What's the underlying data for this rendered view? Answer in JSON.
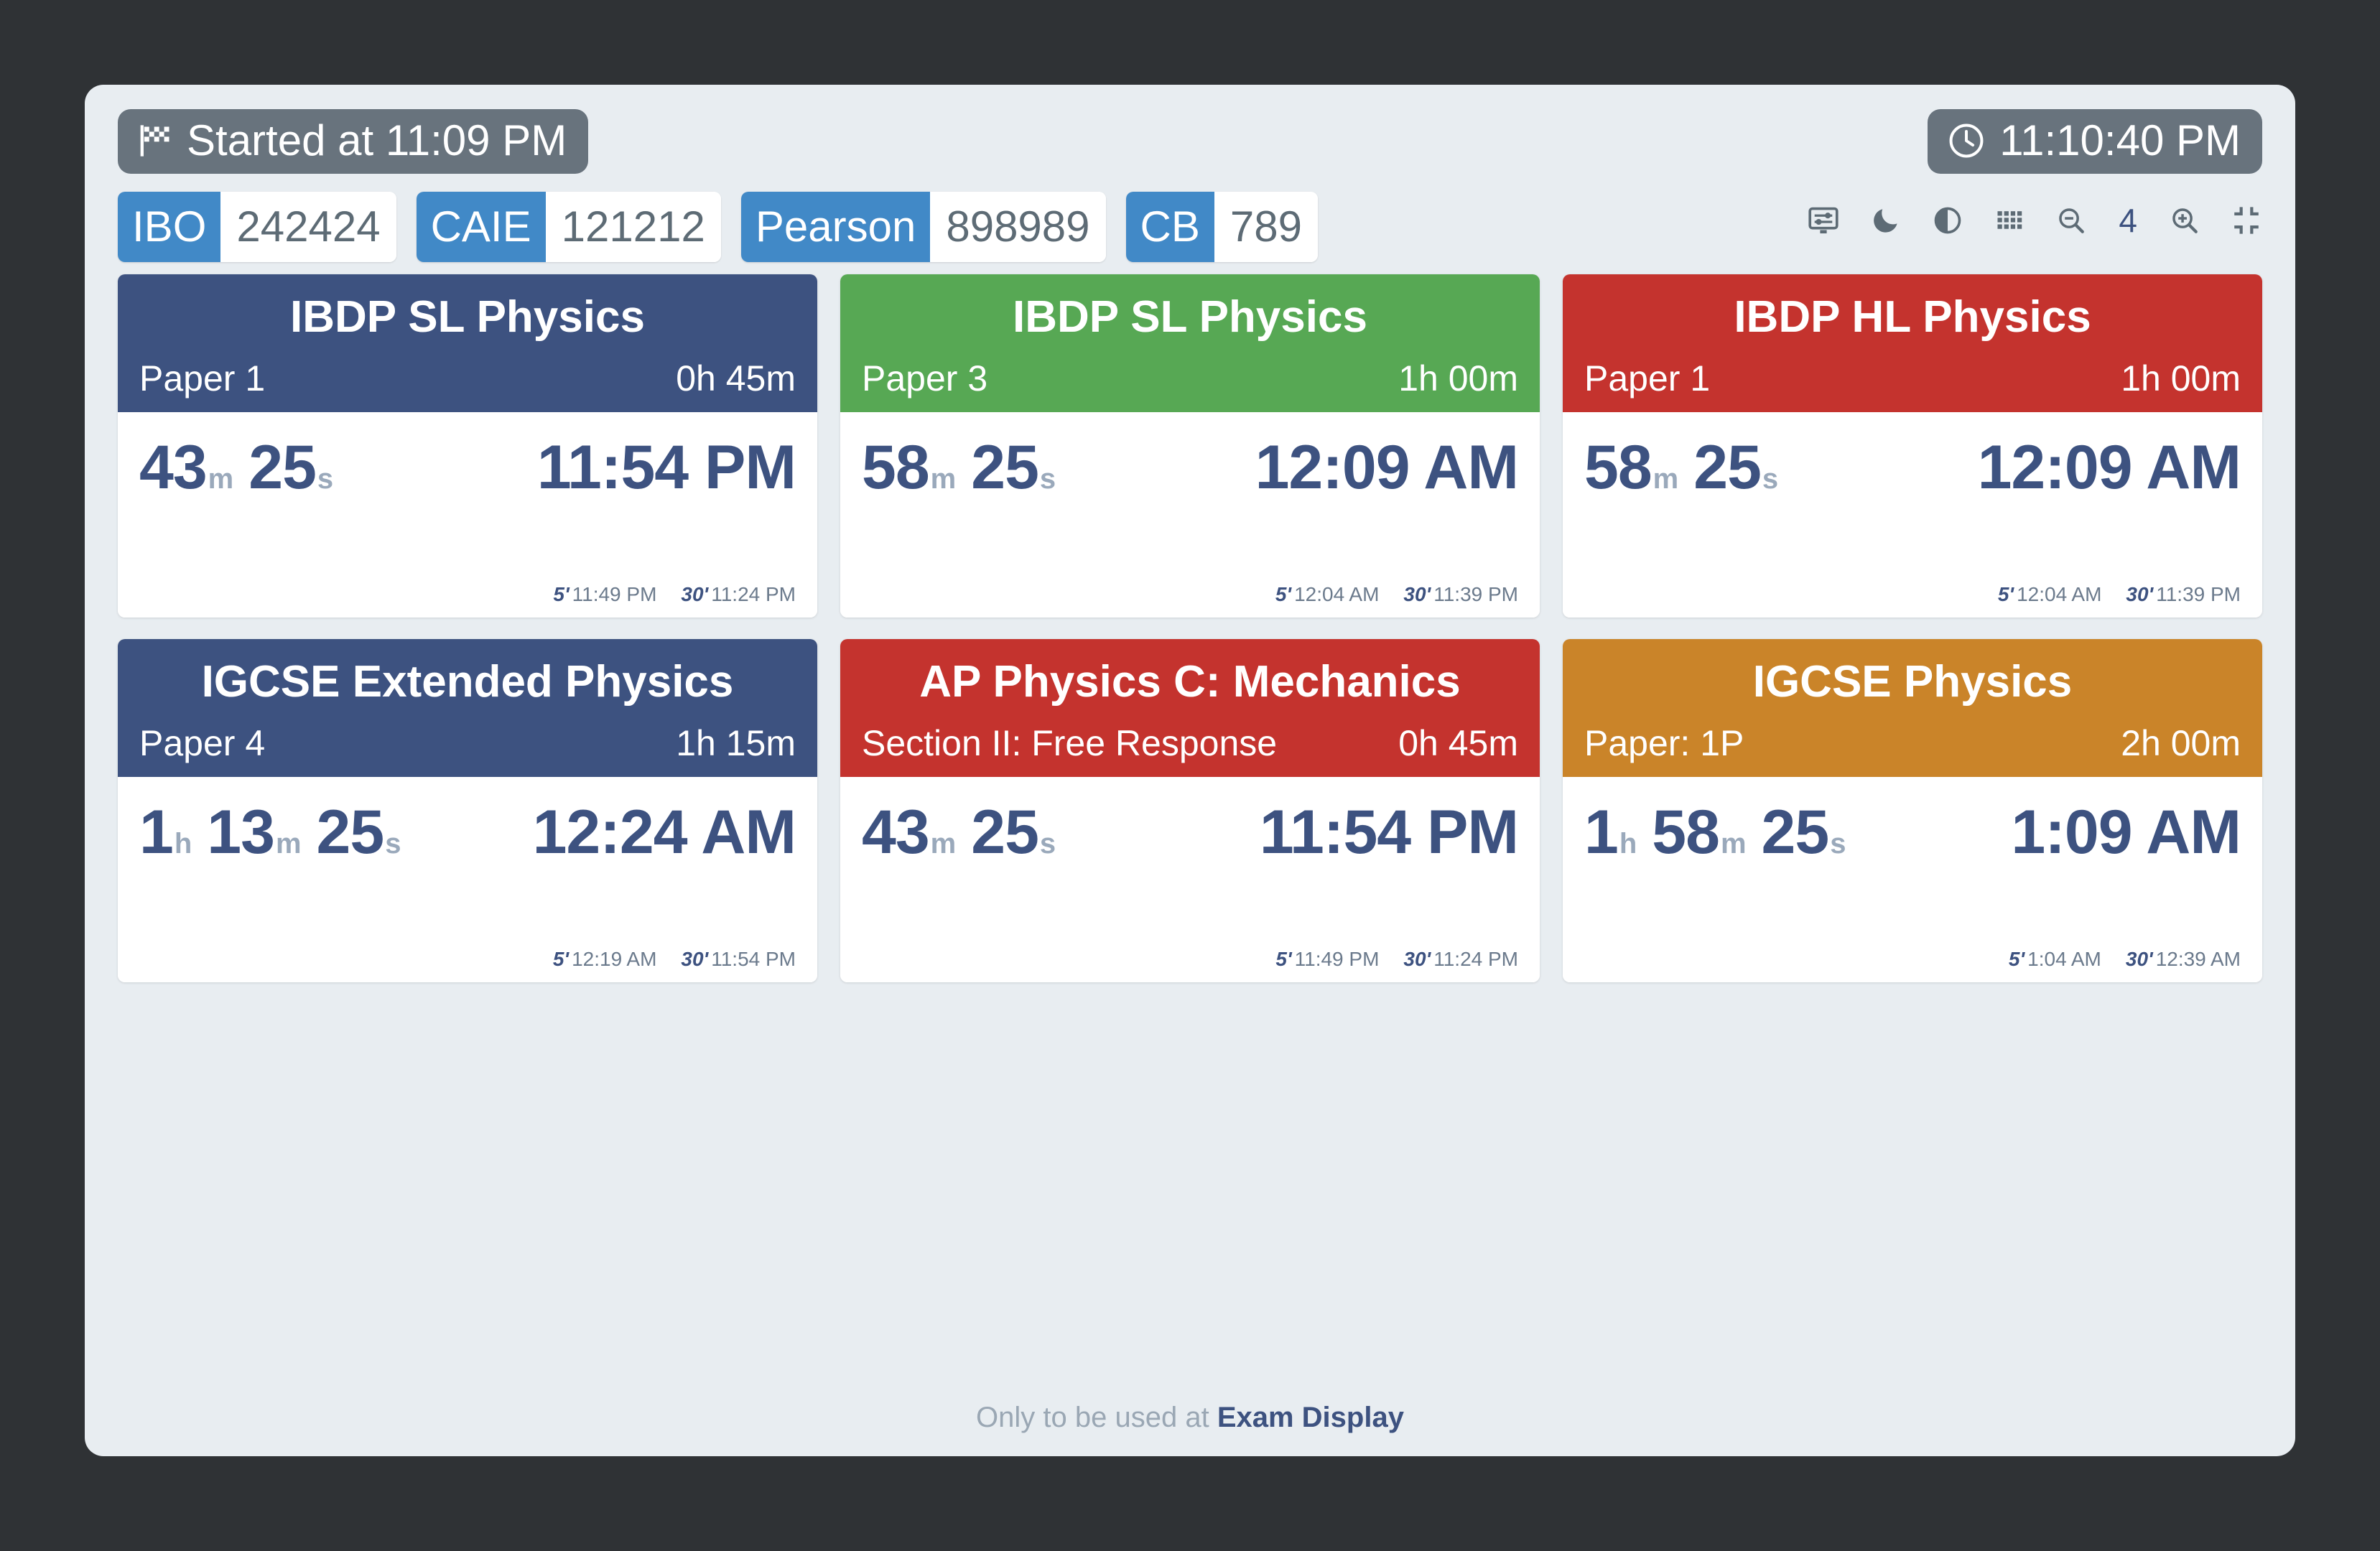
{
  "theme": {
    "page_background": "#2f3235",
    "panel_background": "#e8edf1",
    "accent_blue": "#4189c7",
    "navy": "#3d5280",
    "green": "#57a854",
    "red": "#c4332e",
    "orange": "#ca8429",
    "pill_gray": "#68737d"
  },
  "topbar": {
    "started": {
      "icon": "checkered-flag-icon",
      "label": "Started at 11:09 PM"
    },
    "clock": {
      "icon": "clock-icon",
      "time": "11:10:40 PM"
    }
  },
  "codes": [
    {
      "board": "IBO",
      "number": "242424"
    },
    {
      "board": "CAIE",
      "number": "121212"
    },
    {
      "board": "Pearson",
      "number": "898989"
    },
    {
      "board": "CB",
      "number": "789"
    }
  ],
  "toolbar": {
    "items": [
      {
        "icon": "display-settings-icon"
      },
      {
        "icon": "moon-icon"
      },
      {
        "icon": "contrast-icon"
      },
      {
        "icon": "grid-icon"
      },
      {
        "icon": "zoom-out-icon"
      }
    ],
    "zoom_level": "4",
    "zoom_in": {
      "icon": "zoom-in-icon"
    },
    "compress": {
      "icon": "compress-icon"
    }
  },
  "cards": [
    {
      "title": "IBDP SL Physics",
      "paper": "Paper 1",
      "duration": "0h 45m",
      "color": "#3d5280",
      "remaining": [
        {
          "value": "43",
          "unit": "m"
        },
        {
          "value": "25",
          "unit": "s"
        }
      ],
      "end_time": "11:54 PM",
      "warnings": [
        {
          "mark": "5'",
          "time": "11:49 PM"
        },
        {
          "mark": "30'",
          "time": "11:24 PM"
        }
      ]
    },
    {
      "title": "IBDP SL Physics",
      "paper": "Paper 3",
      "duration": "1h 00m",
      "color": "#57a854",
      "remaining": [
        {
          "value": "58",
          "unit": "m"
        },
        {
          "value": "25",
          "unit": "s"
        }
      ],
      "end_time": "12:09 AM",
      "warnings": [
        {
          "mark": "5'",
          "time": "12:04 AM"
        },
        {
          "mark": "30'",
          "time": "11:39 PM"
        }
      ]
    },
    {
      "title": "IBDP HL Physics",
      "paper": "Paper 1",
      "duration": "1h 00m",
      "color": "#c4332e",
      "remaining": [
        {
          "value": "58",
          "unit": "m"
        },
        {
          "value": "25",
          "unit": "s"
        }
      ],
      "end_time": "12:09 AM",
      "warnings": [
        {
          "mark": "5'",
          "time": "12:04 AM"
        },
        {
          "mark": "30'",
          "time": "11:39 PM"
        }
      ]
    },
    {
      "title": "IGCSE Extended Physics",
      "paper": "Paper 4",
      "duration": "1h 15m",
      "color": "#3d5280",
      "remaining": [
        {
          "value": "1",
          "unit": "h"
        },
        {
          "value": "13",
          "unit": "m"
        },
        {
          "value": "25",
          "unit": "s"
        }
      ],
      "end_time": "12:24 AM",
      "warnings": [
        {
          "mark": "5'",
          "time": "12:19 AM"
        },
        {
          "mark": "30'",
          "time": "11:54 PM"
        }
      ]
    },
    {
      "title": "AP Physics C: Mechanics",
      "paper": "Section II: Free Response",
      "duration": "0h 45m",
      "color": "#c4332e",
      "remaining": [
        {
          "value": "43",
          "unit": "m"
        },
        {
          "value": "25",
          "unit": "s"
        }
      ],
      "end_time": "11:54 PM",
      "warnings": [
        {
          "mark": "5'",
          "time": "11:49 PM"
        },
        {
          "mark": "30'",
          "time": "11:24 PM"
        }
      ]
    },
    {
      "title": "IGCSE Physics",
      "paper": "Paper: 1P",
      "duration": "2h 00m",
      "color": "#ca8429",
      "remaining": [
        {
          "value": "1",
          "unit": "h"
        },
        {
          "value": "58",
          "unit": "m"
        },
        {
          "value": "25",
          "unit": "s"
        }
      ],
      "end_time": "1:09 AM",
      "warnings": [
        {
          "mark": "5'",
          "time": "1:04 AM"
        },
        {
          "mark": "30'",
          "time": "12:39 AM"
        }
      ]
    }
  ],
  "footer": {
    "prefix": "Only to be used at ",
    "brand": "Exam Display"
  }
}
